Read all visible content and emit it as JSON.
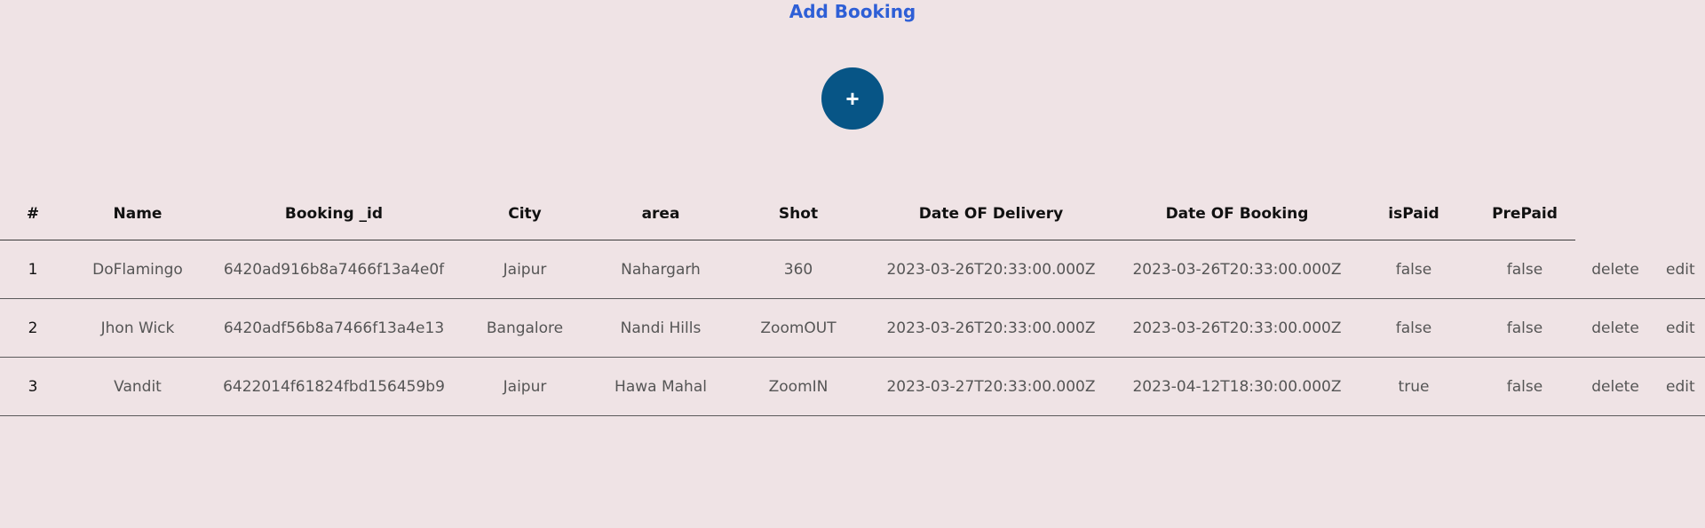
{
  "header": {
    "title": "Add Booking",
    "add_button_symbol": "+"
  },
  "colors": {
    "background": "#efe3e5",
    "title": "#2e5fd6",
    "add_button": "#075586"
  },
  "table": {
    "columns": [
      "#",
      "Name",
      "Booking _id",
      "City",
      "area",
      "Shot",
      "Date OF Delivery",
      "Date OF Booking",
      "isPaid",
      "PrePaid"
    ],
    "rows": [
      {
        "index": "1",
        "name": "DoFlamingo",
        "booking_id": "6420ad916b8a7466f13a4e0f",
        "city": "Jaipur",
        "area": "Nahargarh",
        "shot": "360",
        "date_delivery": "2023-03-26T20:33:00.000Z",
        "date_booking": "2023-03-26T20:33:00.000Z",
        "is_paid": "false",
        "prepaid": "false",
        "delete_label": "delete",
        "edit_label": "edit"
      },
      {
        "index": "2",
        "name": "Jhon Wick",
        "booking_id": "6420adf56b8a7466f13a4e13",
        "city": "Bangalore",
        "area": "Nandi Hills",
        "shot": "ZoomOUT",
        "date_delivery": "2023-03-26T20:33:00.000Z",
        "date_booking": "2023-03-26T20:33:00.000Z",
        "is_paid": "false",
        "prepaid": "false",
        "delete_label": "delete",
        "edit_label": "edit"
      },
      {
        "index": "3",
        "name": "Vandit",
        "booking_id": "6422014f61824fbd156459b9",
        "city": "Jaipur",
        "area": "Hawa Mahal",
        "shot": "ZoomIN",
        "date_delivery": "2023-03-27T20:33:00.000Z",
        "date_booking": "2023-04-12T18:30:00.000Z",
        "is_paid": "true",
        "prepaid": "false",
        "delete_label": "delete",
        "edit_label": "edit"
      }
    ]
  }
}
